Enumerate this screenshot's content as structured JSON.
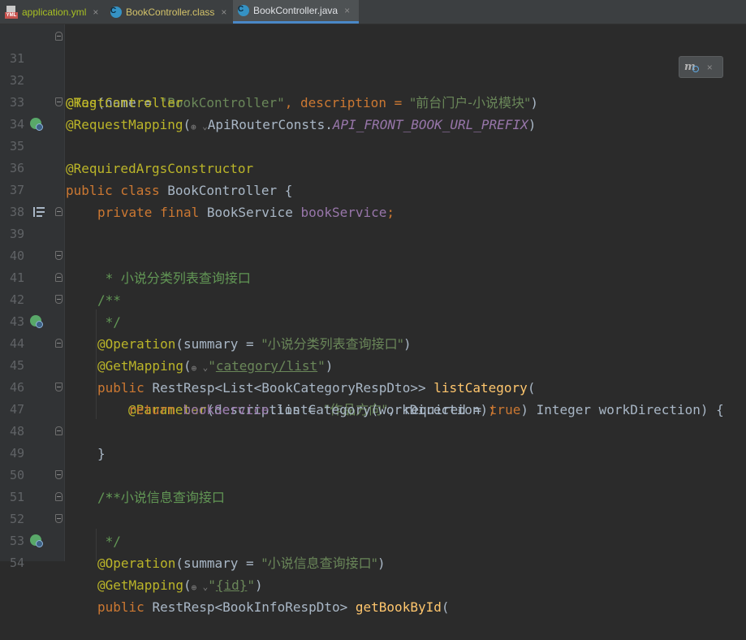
{
  "tabs": [
    {
      "label": "application.yml",
      "icon": "yml-file-icon",
      "color": "#a8c023",
      "active": false
    },
    {
      "label": "BookController.class",
      "icon": "class-file-icon",
      "color": "#d4c36a",
      "active": false
    },
    {
      "label": "BookController.java",
      "icon": "class-file-icon",
      "color": "#dfe1e5",
      "active": true
    }
  ],
  "close_glyph": "×",
  "hint": {
    "icon": "maven-reload-icon",
    "m": "m",
    "close": "×"
  },
  "lines": {
    "l31": {
      "n": "31",
      "t1": "@Tag",
      "t2": "(name = ",
      "t3": "\"BookController\"",
      "t4": ", description = ",
      "t5": "\"前台门户-小说模块\"",
      "t6": ")"
    },
    "l32": {
      "n": "32",
      "t1": "@RestController"
    },
    "l33": {
      "n": "33",
      "t1": "@RequestMapping",
      "t2": "(",
      "t3": "ApiRouterConsts.",
      "t4": "API_FRONT_BOOK_URL_PREFIX",
      "t5": ")"
    },
    "l34": {
      "n": "34",
      "t1": "@RequiredArgsConstructor"
    },
    "l35": {
      "n": "35",
      "t1": "public class ",
      "t2": "BookController {"
    },
    "l36": {
      "n": "36"
    },
    "l37": {
      "n": "37",
      "t1": "private final ",
      "t2": "BookService ",
      "t3": "bookService",
      "t4": ";"
    },
    "l38": {
      "n": "38"
    },
    "l39": {
      "n": "39",
      "t1": "/**"
    },
    "l40": {
      "n": "40",
      "t1": " * ",
      "t2": "小说分类列表查询接口"
    },
    "l41": {
      "n": "41",
      "t1": " */"
    },
    "l42": {
      "n": "42",
      "t1": "@Operation",
      "t2": "(summary = ",
      "t3": "\"小说分类列表查询接口\"",
      "t4": ")"
    },
    "l43": {
      "n": "43",
      "t1": "@GetMapping",
      "t2": "(",
      "t3": "\"",
      "t4": "category/list",
      "t5": "\"",
      "t6": ")"
    },
    "l44": {
      "n": "44",
      "t1": "public ",
      "t2": "RestResp<List<BookCategoryRespDto>> ",
      "t3": "listCategory",
      "t4": "("
    },
    "l45": {
      "n": "45",
      "t1": "@Parameter",
      "t2": "(description = ",
      "t3": "\"作品方向\"",
      "t4": ", required = ",
      "t5": "true",
      "t6": ") Integer workDirection) {"
    },
    "l46": {
      "n": "46",
      "t1": "return ",
      "t2": "bookService",
      "t3": ".listCategory(workDirection)",
      "t4": ";"
    },
    "l47": {
      "n": "47",
      "t1": "}"
    },
    "l48": {
      "n": "48"
    },
    "l49": {
      "n": "49",
      "t1": "/**"
    },
    "l50": {
      "n": "50",
      "t1": " * ",
      "t2": "小说信息查询接口"
    },
    "l51": {
      "n": "51",
      "t1": " */"
    },
    "l52": {
      "n": "52",
      "t1": "@Operation",
      "t2": "(summary = ",
      "t3": "\"小说信息查询接口\"",
      "t4": ")"
    },
    "l53": {
      "n": "53",
      "t1": "@GetMapping",
      "t2": "(",
      "t3": "\"",
      "t4": "{id}",
      "t5": "\"",
      "t6": ")"
    },
    "l54": {
      "n": "54",
      "t1": "public ",
      "t2": "RestResp<BookInfoRespDto> ",
      "t3": "getBookById",
      "t4": "("
    }
  },
  "web_glyph": "⊕",
  "web_caret": "⌄"
}
